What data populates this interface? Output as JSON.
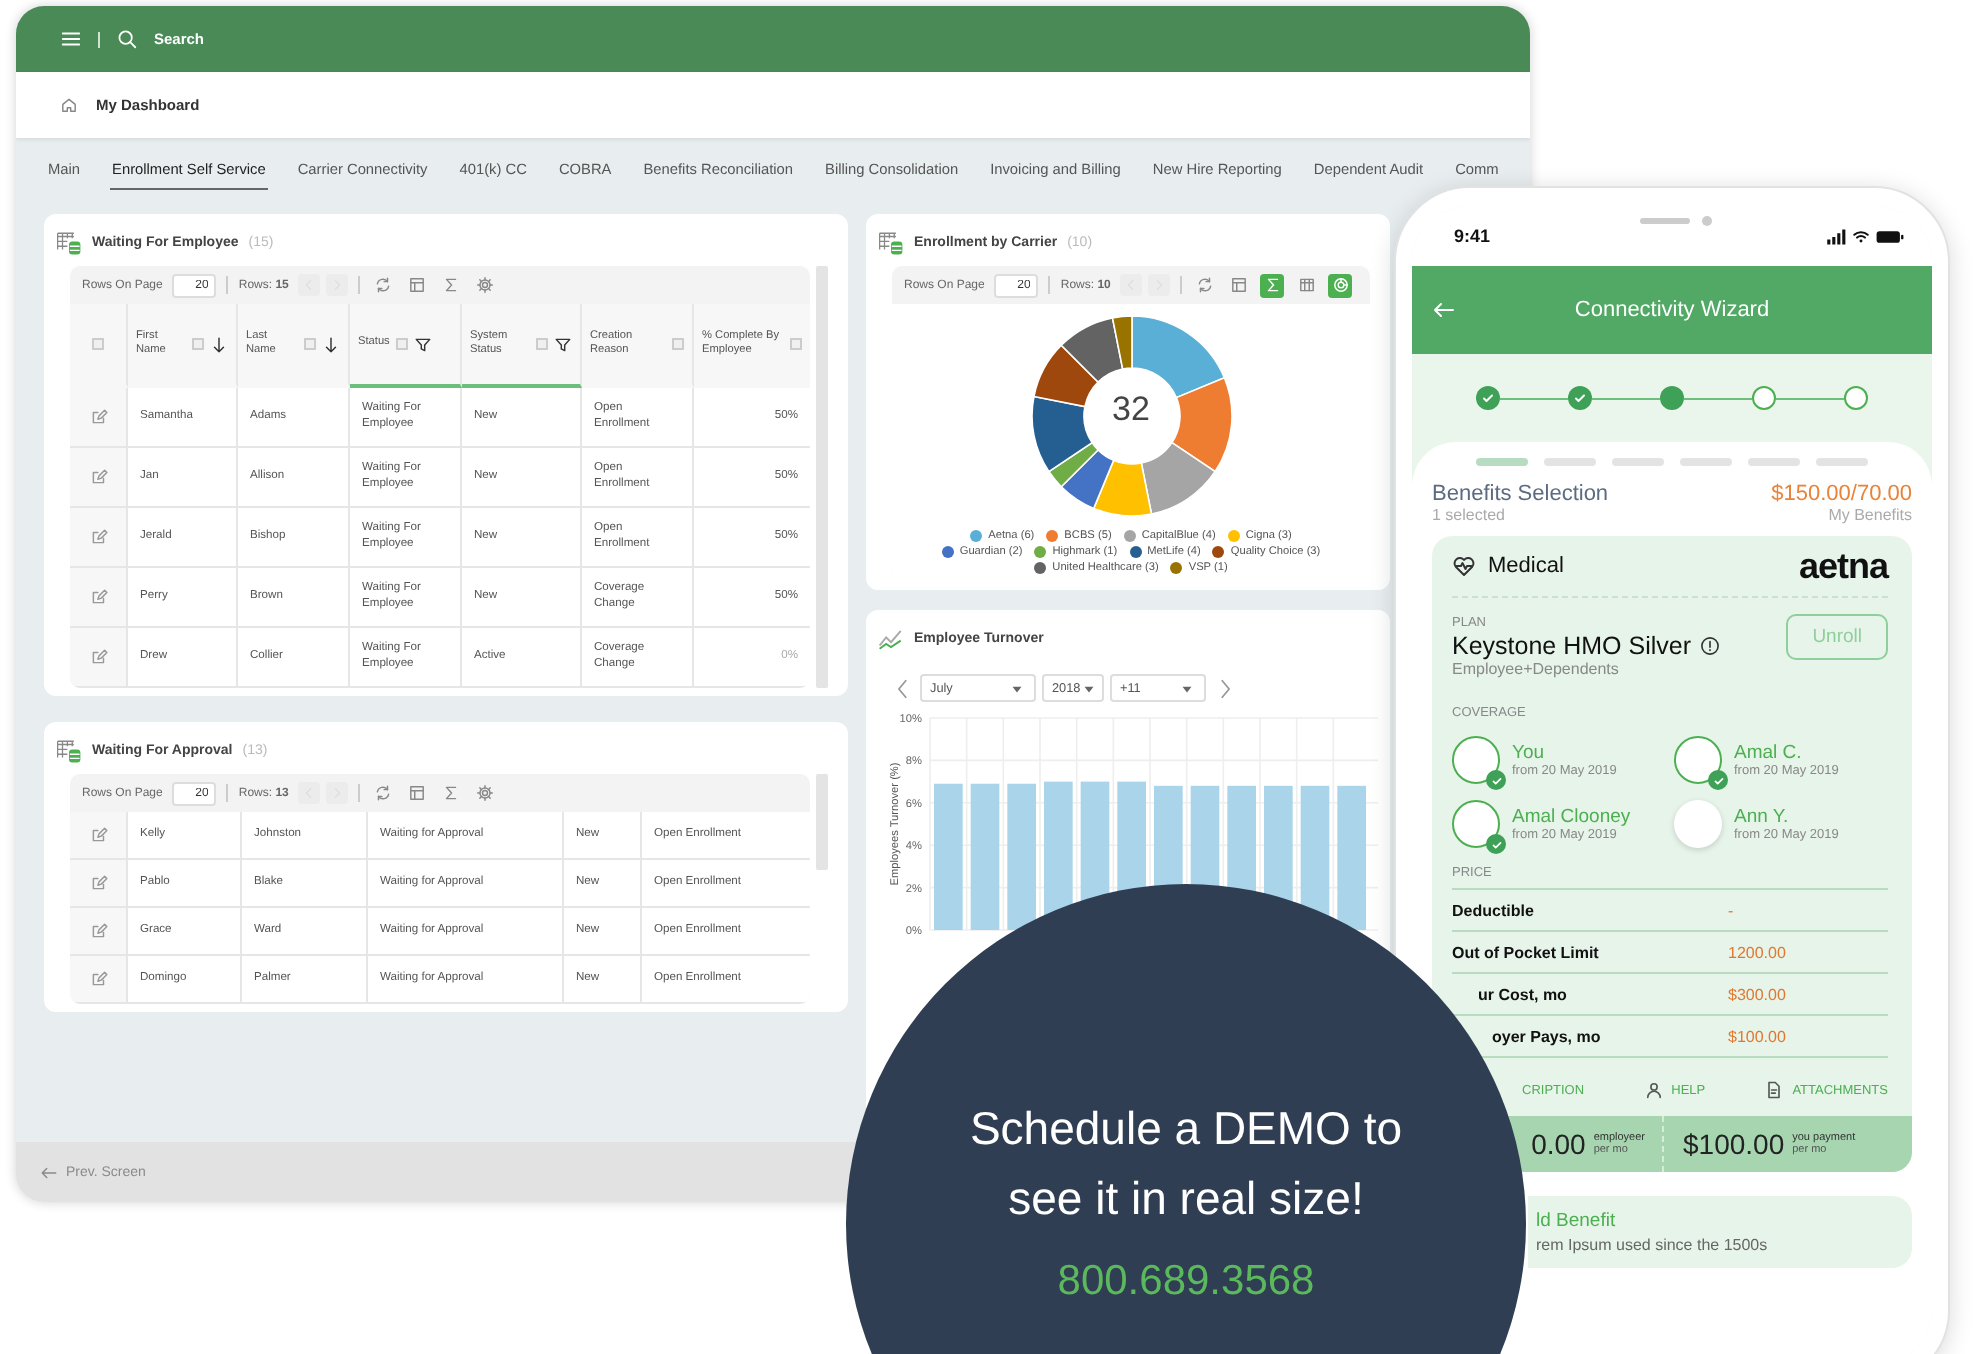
{
  "dashboard": {
    "search": {
      "placeholder": "Search"
    },
    "breadcrumb": "My Dashboard",
    "tabs": [
      {
        "label": "Main",
        "selected": false
      },
      {
        "label": "Enrollment Self Service",
        "selected": true
      },
      {
        "label": "Carrier Connectivity",
        "selected": false
      },
      {
        "label": "401(k) CC",
        "selected": false
      },
      {
        "label": "COBRA",
        "selected": false
      },
      {
        "label": "Benefits Reconciliation",
        "selected": false
      },
      {
        "label": "Billing Consolidation",
        "selected": false
      },
      {
        "label": "Invoicing and Billing",
        "selected": false
      },
      {
        "label": "New Hire Reporting",
        "selected": false
      },
      {
        "label": "Dependent Audit",
        "selected": false
      },
      {
        "label": "Comm",
        "selected": false
      }
    ],
    "employee_panel": {
      "title": "Waiting For Employee",
      "count": "(15)",
      "rows_on_page_label": "Rows On Page",
      "rows_on_page": "20",
      "rows_label": "Rows: **15**",
      "tools": [
        {
          "kind": "refresh",
          "on": false
        },
        {
          "kind": "columns",
          "on": false
        },
        {
          "kind": "sum",
          "on": false
        },
        {
          "kind": "gear",
          "on": false
        }
      ],
      "select_all_checked": false,
      "columns": [
        {
          "label": "First Name",
          "kind": "sort",
          "active": false
        },
        {
          "label": "Last Name",
          "kind": "sort",
          "active": false
        },
        {
          "label": "Status",
          "kind": "filter",
          "active": true
        },
        {
          "label": "System Status",
          "kind": "filter",
          "active": true
        },
        {
          "label": "Creation Reason",
          "kind": "plain",
          "active": false
        },
        {
          "label": "% Complete By Employee",
          "kind": "plain",
          "active": false
        }
      ],
      "rows": [
        {
          "cells": [
            "Samantha",
            "Adams",
            "Waiting For Employee",
            "New",
            "Open Enrollment",
            "50%"
          ],
          "complete_muted": false
        },
        {
          "cells": [
            "Jan",
            "Allison",
            "Waiting For Employee",
            "New",
            "Open Enrollment",
            "50%"
          ],
          "complete_muted": false
        },
        {
          "cells": [
            "Jerald",
            "Bishop",
            "Waiting For Employee",
            "New",
            "Open Enrollment",
            "50%"
          ],
          "complete_muted": false
        },
        {
          "cells": [
            "Perry",
            "Brown",
            "Waiting For Employee",
            "New",
            "Coverage Change",
            "50%"
          ],
          "complete_muted": false
        },
        {
          "cells": [
            "Drew",
            "Collier",
            "Waiting For Employee",
            "Active",
            "Coverage Change",
            "0%"
          ],
          "complete_muted": true
        }
      ]
    },
    "approval_panel": {
      "title": "Waiting For Approval",
      "count": "(13)",
      "rows_on_page_label": "Rows On Page",
      "rows_on_page": "20",
      "rows_label": "Rows: **13**",
      "tools": [
        {
          "kind": "refresh",
          "on": false
        },
        {
          "kind": "columns",
          "on": false
        },
        {
          "kind": "sum",
          "on": false
        },
        {
          "kind": "gear",
          "on": false
        }
      ],
      "rows": [
        {
          "cells": [
            "Kelly",
            "Johnston",
            "Waiting for Approval",
            "New",
            "Open Enrollment"
          ]
        },
        {
          "cells": [
            "Pablo",
            "Blake",
            "Waiting for Approval",
            "New",
            "Open Enrollment"
          ]
        },
        {
          "cells": [
            "Grace",
            "Ward",
            "Waiting for Approval",
            "New",
            "Open Enrollment"
          ]
        },
        {
          "cells": [
            "Domingo",
            "Palmer",
            "Waiting for Approval",
            "New",
            "Open Enrollment"
          ]
        }
      ]
    },
    "carrier_panel": {
      "title": "Enrollment by Carrier",
      "count": "(10)",
      "rows_on_page_label": "Rows On Page",
      "rows_on_page": "20",
      "rows_label": "Rows: **10**",
      "tools": [
        {
          "kind": "refresh",
          "on": false
        },
        {
          "kind": "columns",
          "on": false
        },
        {
          "kind": "sum",
          "on": true
        },
        {
          "kind": "grid",
          "on": false
        },
        {
          "kind": "donut",
          "on": true
        }
      ],
      "total": "32",
      "chart_data": {
        "type": "donut",
        "categories": [
          "Aetna",
          "BCBS",
          "CapitalBlue",
          "Cigna",
          "Guardian",
          "Highmark",
          "MetLife",
          "Quality Choice",
          "United Healthcare",
          "VSP"
        ],
        "values": [
          18.75,
          15.625,
          12.5,
          9.375,
          6.25,
          3.125,
          12.5,
          9.375,
          9.375,
          3.125
        ]
      },
      "legend": [
        {
          "count": "(6)",
          "color": "#5aafd6"
        },
        {
          "count": "(5)",
          "color": "#ee7d31"
        },
        {
          "count": "(4)",
          "color": "#a5a5a5"
        },
        {
          "count": "(3)",
          "color": "#ffc000"
        },
        {
          "count": "(2)",
          "color": "#4472c4"
        },
        {
          "count": "(1)",
          "color": "#70ad47"
        },
        {
          "count": "(4)",
          "color": "#255e91"
        },
        {
          "count": "(3)",
          "color": "#9e480e"
        },
        {
          "count": "(3)",
          "color": "#636363"
        },
        {
          "count": "(1)",
          "color": "#997300"
        }
      ]
    },
    "turnover_panel": {
      "title": "Employee Turnover",
      "month": "July",
      "year": "2018",
      "span": "+11",
      "chart_data": {
        "type": "bar",
        "grid": true,
        "ylabel": "Employees Turnover (%)",
        "ylim": [
          0,
          10
        ],
        "yticks": [
          {
            "value": 0,
            "label": "0%"
          },
          {
            "value": 2,
            "label": "2%"
          },
          {
            "value": 4,
            "label": "4%"
          },
          {
            "value": 6,
            "label": "6%"
          },
          {
            "value": 8,
            "label": "8%"
          },
          {
            "value": 10,
            "label": "10%"
          }
        ],
        "series": [
          {
            "color": "#a9d4ea",
            "values": [
              6.9,
              6.9,
              6.9,
              7.0,
              7.0,
              7.0,
              6.8,
              6.8,
              6.8,
              6.8,
              6.8,
              6.8
            ]
          }
        ]
      }
    },
    "footer": {
      "prev": "Prev. Screen"
    }
  },
  "phone": {
    "time": "9:41",
    "title": "Connectivity Wizard",
    "steps": [
      {
        "done": true,
        "current": false
      },
      {
        "done": true,
        "current": false
      },
      {
        "done": false,
        "current": true
      },
      {
        "done": false,
        "current": false
      },
      {
        "done": false,
        "current": false
      }
    ],
    "segments": [
      {
        "selected": true
      },
      {
        "selected": false
      },
      {
        "selected": false
      },
      {
        "selected": false
      },
      {
        "selected": false
      },
      {
        "selected": false
      }
    ],
    "section": "Benefits Selection",
    "selected_count": "1 selected",
    "price": "$150.00/70.00",
    "price_caption": "My Benefits",
    "card": {
      "category": "Medical",
      "carrier": "aetna",
      "plan_label": "PLAN",
      "plan": "Keystone HMO Silver",
      "plan_sub": "Employee+Dependents",
      "unroll": "Unroll",
      "coverage_label": "COVERAGE",
      "members": [
        {
          "name": "You",
          "since": "from 20 May 2019",
          "checked": true
        },
        {
          "name": "Amal C.",
          "since": "from 20 May 2019",
          "checked": true
        },
        {
          "name": "Amal Clooney",
          "since": "from 20 May 2019",
          "checked": true
        },
        {
          "name": "Ann Y.",
          "since": "from 20 May 2019",
          "checked": false
        }
      ],
      "price_label": "PRICE",
      "price_rows": [
        {
          "label": "Deductible",
          "value": "-"
        },
        {
          "label": "Out of Pocket Limit",
          "value": "1200.00"
        },
        {
          "label": "ur Cost, mo",
          "value": "$300.00"
        },
        {
          "label": "oyer Pays, mo",
          "value": "$100.00"
        }
      ],
      "links": [
        {
          "kind": "doc",
          "label": "CRIPTION"
        },
        {
          "kind": "user",
          "label": "HELP"
        },
        {
          "kind": "attach",
          "label": "ATTACHMENTS"
        }
      ],
      "totals": [
        {
          "amount": "0.00",
          "caption": "employeer",
          "per": "per mo"
        },
        {
          "amount": "$100.00",
          "caption": "you payment",
          "per": "per mo"
        }
      ]
    },
    "add": {
      "title": "ld Benefit",
      "text": "rem Ipsum used since the 1500s"
    }
  },
  "promo": {
    "text": "Schedule a DEMO to see it in real size!",
    "phone": "800.689.3568"
  }
}
